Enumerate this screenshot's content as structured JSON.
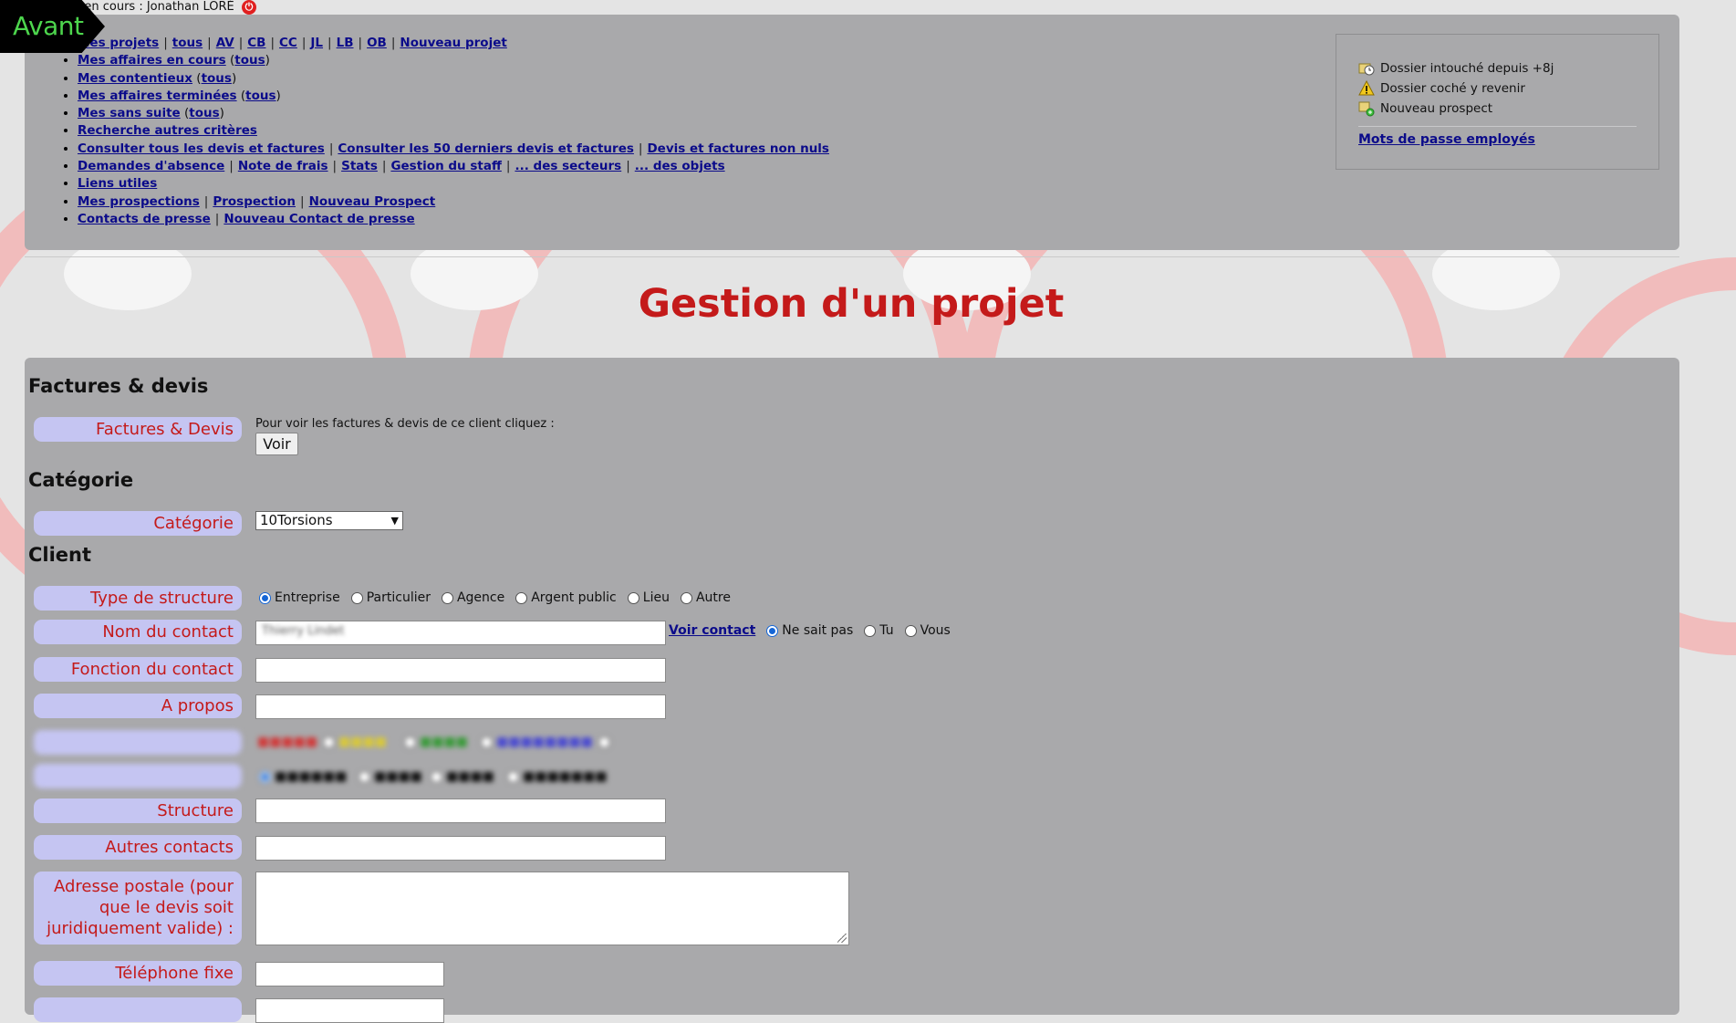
{
  "overlay_badge": "Avant",
  "session": {
    "text": "n en cours : Jonathan LORÉ"
  },
  "nav": {
    "row1": [
      "Mes projets",
      "tous",
      "AV",
      "CB",
      "CC",
      "JL",
      "LB",
      "OB",
      "Nouveau projet"
    ],
    "row2": {
      "link": "Mes affaires en cours",
      "paren": "tous"
    },
    "row3": {
      "link": "Mes contentieux",
      "paren": "tous"
    },
    "row4": {
      "link": "Mes affaires terminées",
      "paren": "tous"
    },
    "row5": {
      "link": "Mes sans suite",
      "paren": "tous"
    },
    "row6": "Recherche autres critères",
    "row7": [
      "Consulter tous les devis et factures",
      "Consulter les 50 derniers devis et factures",
      "Devis et factures non nuls"
    ],
    "row8": [
      "Demandes d'absence",
      "Note de frais",
      "Stats",
      "Gestion du staff",
      "... des secteurs",
      "... des objets"
    ],
    "row9": "Liens utiles",
    "row10": [
      "Mes prospections",
      "Prospection",
      "Nouveau Prospect"
    ],
    "row11": [
      "Contacts de presse",
      "Nouveau Contact de presse"
    ]
  },
  "legend": {
    "items": [
      "Dossier intouché depuis +8j",
      "Dossier coché y revenir",
      "Nouveau prospect"
    ],
    "link": "Mots de passe employés"
  },
  "page_title": "Gestion d'un projet",
  "sections": {
    "factures": {
      "heading": "Factures & devis",
      "label": "Factures & Devis",
      "hint": "Pour voir les factures & devis de ce client cliquez :",
      "button": "Voir"
    },
    "categorie": {
      "heading": "Catégorie",
      "label": "Catégorie",
      "selected": "10Torsions"
    },
    "client": {
      "heading": "Client",
      "type_label": "Type de structure",
      "type_options": [
        "Entreprise",
        "Particulier",
        "Agence",
        "Argent public",
        "Lieu",
        "Autre"
      ],
      "type_selected": "Entreprise",
      "contact_label": "Nom du contact",
      "contact_value": "Thierry Lindet",
      "voir_contact": "Voir contact",
      "address_options": [
        "Ne sait pas",
        "Tu",
        "Vous"
      ],
      "address_selected": "Ne sait pas",
      "fonction_label": "Fonction du contact",
      "apropos_label": "A propos",
      "structure_label": "Structure",
      "autres_label": "Autres contacts",
      "adresse_label": "Adresse postale (pour que le devis soit juridiquement valide) :",
      "tel_label": "Téléphone fixe"
    }
  },
  "colors": {
    "panel": "#a9a9ab",
    "title_red": "#c41a1a",
    "pill": "#c5c5f2",
    "link": "#0b0b8a"
  }
}
